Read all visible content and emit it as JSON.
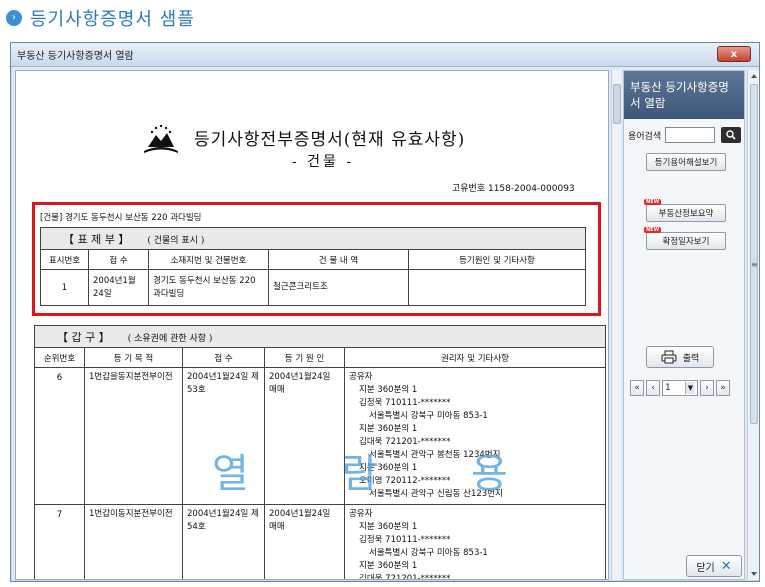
{
  "page": {
    "title": "등기사항증명서 샘플",
    "bullet": "›"
  },
  "window": {
    "title": "부동산 등기사항증명서 열람",
    "close_label": "x"
  },
  "side": {
    "title": "부동산 등기사항증명서 열람",
    "search_label": "용어검색",
    "search_value": "",
    "btn_glossary": "등기용어해설보기",
    "btn_summary": "부동산정보요약",
    "btn_date": "확정일자보기",
    "new_badge": "NEW",
    "print_label": "출력",
    "pager_first": "«",
    "pager_prev": "‹",
    "pager_page": "1",
    "pager_next": "›",
    "pager_last": "»",
    "close_label": "닫기",
    "close_icon": "✕"
  },
  "doc": {
    "title": "등기사항전부증명서(현재 유효사항)",
    "subtitle": "- 건물 -",
    "uid": "고유번호 1158-2004-000093",
    "building_line": "[건물] 경기도 동두천시 보산동 220 과다빌딩",
    "pyoje": {
      "header": "【  표    제    부  】",
      "header_sub": "( 건물의 표시 )",
      "columns": [
        "표시번호",
        "접  수",
        "소재지번 및 건물번호",
        "건 물 내 역",
        "등기원인 및 기타사항"
      ],
      "rows": [
        {
          "no": "1",
          "date": "2004년1월24일",
          "addr": "경기도 동두천시 보산동 220 과다빌딩",
          "detail": "철근콘크리트조",
          "etc": ""
        }
      ]
    },
    "gap": {
      "header": "【  갑          구  】",
      "header_sub": "( 소유권에 관한 사항 )",
      "columns": [
        "순위번호",
        "등 기 목 적",
        "접  수",
        "등 기 원 인",
        "권리자 및 기타사항"
      ],
      "rows": [
        {
          "no": "6",
          "purpose": "1번갑을동지분전부이전",
          "receipt": "2004년1월24일 제53호",
          "cause": "2004년1월24일 매매",
          "rights": [
            {
              "t": "공유자",
              "i": 0
            },
            {
              "t": "지분 360분의 1",
              "i": 1
            },
            {
              "t": "김정욱  710111-*******",
              "i": 1
            },
            {
              "t": "서울특별시 강북구 미아동 853-1",
              "i": 2
            },
            {
              "t": "지분 360분의 1",
              "i": 1
            },
            {
              "t": "김대욱  721201-*******",
              "i": 1
            },
            {
              "t": "서울특별시 관악구 봉천동 1234번지",
              "i": 2
            },
            {
              "t": "지분 360분의 1",
              "i": 1
            },
            {
              "t": "오미영  720112-*******",
              "i": 1
            },
            {
              "t": "서울특별시 관악구 신림동 산123번지",
              "i": 2
            }
          ]
        },
        {
          "no": "7",
          "purpose": "1번갑이동지분전부이전",
          "receipt": "2004년1월24일 제54호",
          "cause": "2004년1월24일 매매",
          "rights": [
            {
              "t": "공유자",
              "i": 0
            },
            {
              "t": "지분 360분의 1",
              "i": 1
            },
            {
              "t": "김정욱  710111-*******",
              "i": 1
            },
            {
              "t": "서울특별시 강북구 미아동 853-1",
              "i": 2
            },
            {
              "t": "지분 360분의 1",
              "i": 1
            },
            {
              "t": "김대욱  721201-*******",
              "i": 1
            }
          ]
        }
      ]
    },
    "watermark": "열 람 용"
  },
  "colors": {
    "accent": "#2b78c5",
    "highlight": "#e0151c",
    "watermark": "#5aa7df"
  }
}
